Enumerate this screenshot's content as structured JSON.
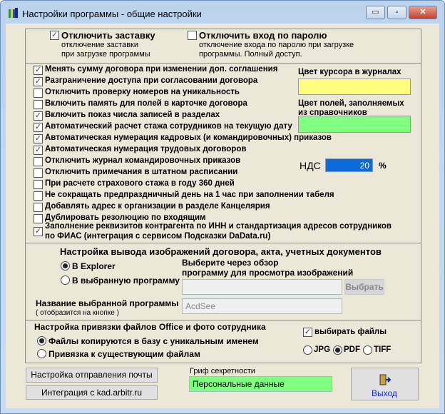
{
  "window": {
    "title": "Настройки программы - общие настройки",
    "minimize": "▭",
    "maximize": "▫",
    "close": "✕"
  },
  "top": {
    "disable_splash": {
      "label": "Отключить заставку",
      "desc1": "отключение заставки",
      "desc2": "при загрузке программы",
      "checked": true
    },
    "disable_password": {
      "label": "Отключить вход по паролю",
      "desc1": "отключение входа по паролю при загрузке",
      "desc2": "программы. Полный доступ.",
      "checked": false
    }
  },
  "options": [
    {
      "label": "Менять сумму договора при изменении доп. соглашения",
      "checked": true
    },
    {
      "label": "Разграничение доступа при согласовании договора",
      "checked": true
    },
    {
      "label": "Отключить проверку номеров на уникальность",
      "checked": false
    },
    {
      "label": "Включить память для полей в карточке договора",
      "checked": false
    },
    {
      "label": "Включить показ числа записей в разделах",
      "checked": true
    },
    {
      "label": "Автоматический расчет стажа сотрудников на текущую дату",
      "checked": true
    },
    {
      "label": "Автоматическая нумерация кадровых (и командировочных) приказов",
      "checked": true
    },
    {
      "label": "Автоматическая нумерация трудовых договоров",
      "checked": true
    },
    {
      "label": "Отключить журнал командировочных приказов",
      "checked": false
    },
    {
      "label": "Отключить примечания в штатном расписании",
      "checked": false
    },
    {
      "label": "При расчете страхового стажа в году 360 дней",
      "checked": false
    },
    {
      "label": "Не сокращать предпраздничный день на 1 час при заполнении табеля",
      "checked": false
    },
    {
      "label": "Добавлять адрес к организации в разделе Канцелярия",
      "checked": false
    },
    {
      "label": "Дублировать резолюцию по входящим",
      "checked": false
    }
  ],
  "dadata": {
    "line1": "Заполнение реквизитов контрагента по ИНН и стандартизация адресов сотрудников",
    "line2": "по ФИАС (интеграция с сервисом Подсказки DaData.ru)",
    "checked": true
  },
  "colors": {
    "cursor_label": "Цвет курсора в журналах",
    "cursor_color": "#ffff80",
    "fields_label1": "Цвет полей, заполняемых",
    "fields_label2": "из справочников",
    "fields_color": "#80ff80"
  },
  "vat": {
    "label": "НДС",
    "value": "20",
    "unit": "%"
  },
  "images": {
    "title": "Настройка вывода изображений договора,  акта, учетных документов",
    "opt_explorer": "В Explorer",
    "opt_program": "В выбранную программу",
    "selected": "explorer",
    "browse_label1": "Выберите через обзор",
    "browse_label2": "программу для просмотра изображений",
    "path_value": "",
    "browse_button": "Выбрать",
    "name_label": "Название выбранной программы",
    "name_hint": "( отобразится на кнопке )",
    "name_value": "AcdSee"
  },
  "office": {
    "title": "Настройка привязки файлов Office и фото сотрудника",
    "opt_copy": "Файлы копируются в базу с уникальным именем",
    "opt_link": "Привязка к существующим файлам",
    "selected": "copy",
    "choose_files": "выбирать файлы",
    "choose_checked": true,
    "fmt_jpg": "JPG",
    "fmt_pdf": "PDF",
    "fmt_tiff": "TIFF",
    "format": "PDF"
  },
  "footer": {
    "mail_button": "Настройка отправления почты",
    "kad_button": "Интеграция с kad.arbitr.ru",
    "secrecy_label": "Гриф секретности",
    "secrecy_value": "Персональные данные",
    "exit_button": "Выход"
  }
}
